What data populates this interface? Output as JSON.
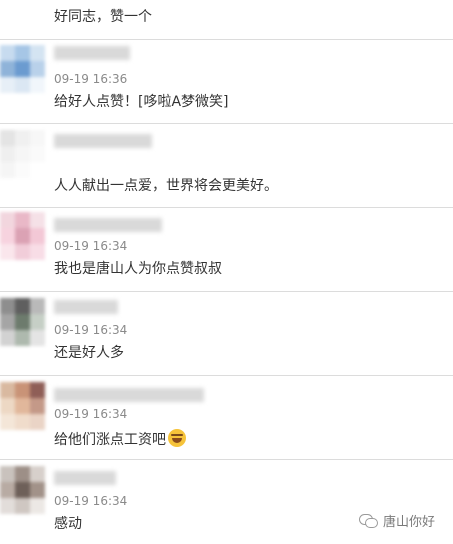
{
  "comments": [
    {
      "time": "",
      "text": "好同志，赞一个"
    },
    {
      "time": "09-19 16:36",
      "text": "给好人点赞！[哆啦A梦微笑]"
    },
    {
      "time": "",
      "text": "人人献出一点爱，世界将会更美好。"
    },
    {
      "time": "09-19 16:34",
      "text": "我也是唐山人为你点赞叔叔"
    },
    {
      "time": "09-19 16:34",
      "text": "还是好人多"
    },
    {
      "time": "09-19 16:34",
      "text": "给他们涨点工资吧"
    },
    {
      "time": "09-19 16:34",
      "text": "感动"
    }
  ],
  "emoji_icon": "laughing-tears-emoji",
  "watermark": {
    "text": "唐山你好",
    "icon": "wechat-icon"
  }
}
